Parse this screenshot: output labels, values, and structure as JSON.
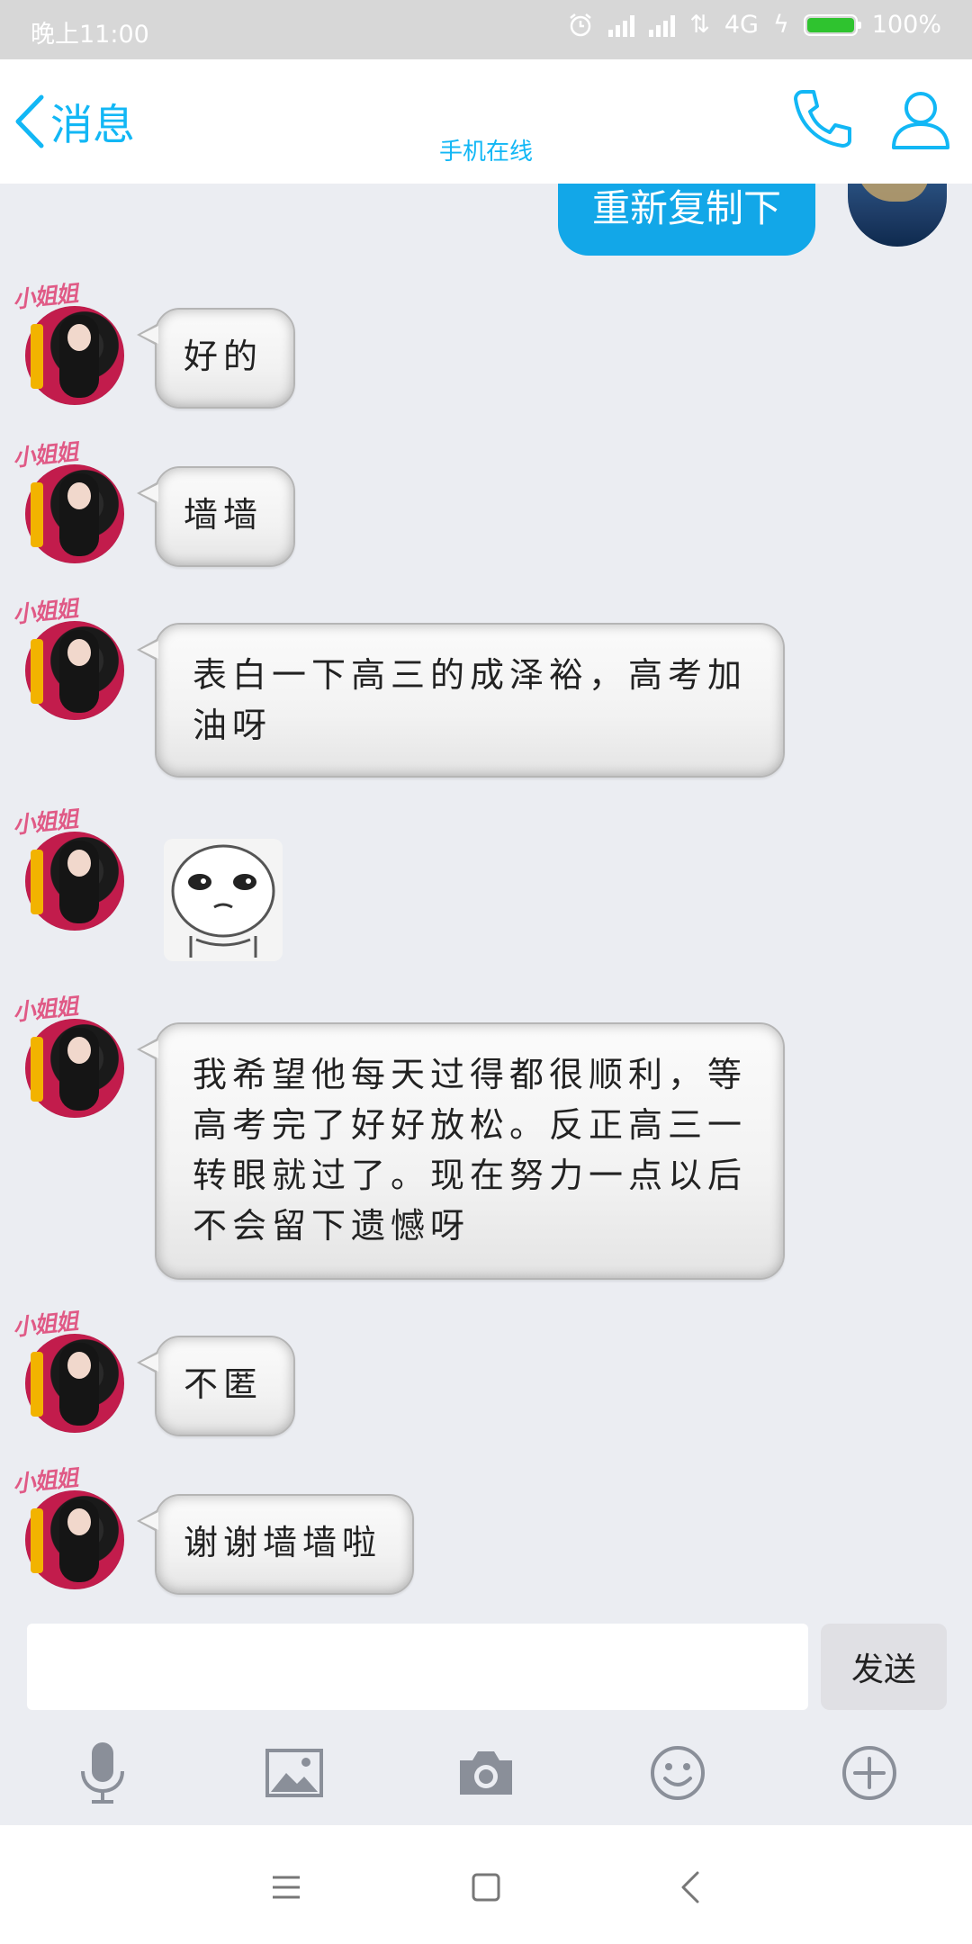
{
  "status_bar": {
    "time": "晚上11:00",
    "network": "4G",
    "battery": "100%",
    "battery_level": 1.0,
    "battery_color": "#2fc32f"
  },
  "header": {
    "back_label": "消息",
    "subtitle": "手机在线",
    "accent_color": "#12b7f5",
    "icons": [
      "phone-icon",
      "profile-icon"
    ]
  },
  "chat": {
    "sent_partial": "重新复制下",
    "avatar_tag": "小姐姐",
    "messages": [
      {
        "type": "text",
        "text": "好的"
      },
      {
        "type": "text",
        "text": "墙墙"
      },
      {
        "type": "text",
        "text": "表白一下高三的成泽裕，高考加油呀"
      },
      {
        "type": "sticker",
        "text": ""
      },
      {
        "type": "text",
        "text": "我希望他每天过得都很顺利，等高考完了好好放松。反正高三一转眼就过了。现在努力一点以后不会留下遗憾呀"
      },
      {
        "type": "text",
        "text": "不匿"
      },
      {
        "type": "text",
        "text": "谢谢墙墙啦"
      }
    ]
  },
  "input": {
    "value": "",
    "placeholder": "",
    "send_label": "发送"
  },
  "toolbar": {
    "icons": [
      "microphone-icon",
      "image-icon",
      "camera-icon",
      "emoji-icon",
      "plus-icon"
    ]
  },
  "nav": {
    "icons": [
      "menu-icon",
      "home-icon",
      "back-icon"
    ]
  }
}
